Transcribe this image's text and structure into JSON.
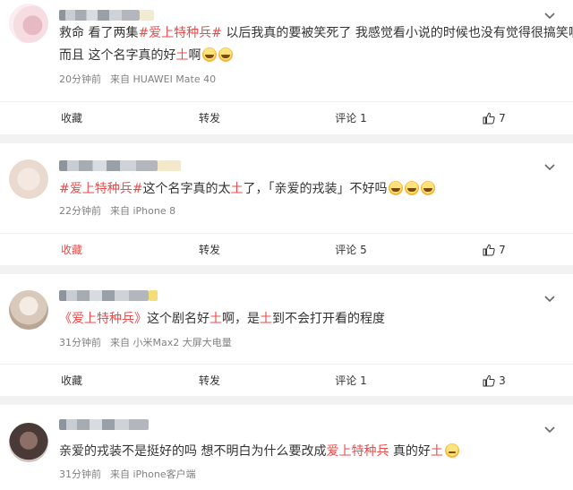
{
  "icons": {
    "expand": "chevron-down-icon",
    "like": "thumbs-up-icon",
    "laugh": "laughing-tears-emoji",
    "smirk": "smirk-emoji"
  },
  "colors": {
    "hashtag": "#eb4a4a",
    "background": "#f2f2f2",
    "meta": "#808080"
  },
  "posts": [
    {
      "text_before": "救命 看了两集",
      "hashtag": "#爱上特种兵#",
      "text_after_line1": " 以后我真的要被笑死了 我感觉看小说的时候也没有觉得很搞笑啊",
      "text_line2_before": "而且 这个名字真的好",
      "text_line2_hl": "土",
      "text_line2_after": "啊",
      "time": "20分钟前",
      "source": "来自 HUAWEI Mate 40",
      "actions": {
        "fav": "收藏",
        "share": "转发",
        "comment": "评论 1",
        "like": "7"
      }
    },
    {
      "hashtag": "#爱上特种兵#",
      "text_mid": "这个名字真的太",
      "hl": "土",
      "text_after": "了，「亲爱的戎装」不好吗",
      "time": "22分钟前",
      "source": "来自 iPhone 8",
      "actions": {
        "fav": "收藏",
        "share": "转发",
        "comment": "评论 5",
        "like": "7"
      }
    },
    {
      "quote_open": "《",
      "title": "爱上特种兵",
      "quote_close": "》",
      "text_mid": "这个剧名好",
      "hl1": "土",
      "text_mid2": "啊，是",
      "hl2": "土",
      "text_after": "到不会打开看的程度",
      "time": "31分钟前",
      "source": "来自 小米Max2 大屏大电量",
      "actions": {
        "fav": "收藏",
        "share": "转发",
        "comment": "评论 1",
        "like": "3"
      }
    },
    {
      "text_before": "亲爱的戎装不是挺好的吗 想不明白为什么要改成",
      "title": "爱上特种兵",
      "text_mid": " 真的好",
      "hl": "土",
      "time": "31分钟前",
      "source": "来自 iPhone客户端"
    }
  ]
}
